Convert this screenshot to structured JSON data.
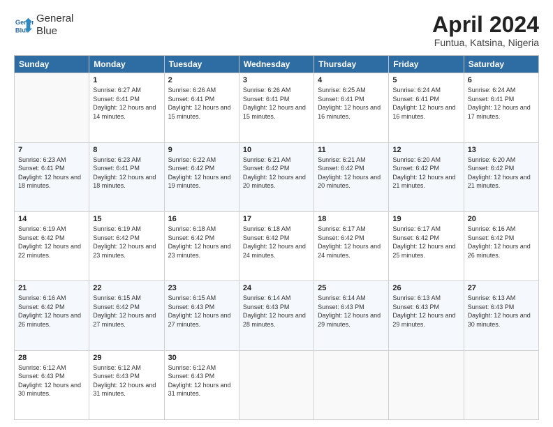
{
  "logo": {
    "line1": "General",
    "line2": "Blue"
  },
  "title": "April 2024",
  "subtitle": "Funtua, Katsina, Nigeria",
  "weekdays": [
    "Sunday",
    "Monday",
    "Tuesday",
    "Wednesday",
    "Thursday",
    "Friday",
    "Saturday"
  ],
  "weeks": [
    [
      {
        "num": "",
        "sunrise": "",
        "sunset": "",
        "daylight": ""
      },
      {
        "num": "1",
        "sunrise": "6:27 AM",
        "sunset": "6:41 PM",
        "daylight": "12 hours and 14 minutes."
      },
      {
        "num": "2",
        "sunrise": "6:26 AM",
        "sunset": "6:41 PM",
        "daylight": "12 hours and 15 minutes."
      },
      {
        "num": "3",
        "sunrise": "6:26 AM",
        "sunset": "6:41 PM",
        "daylight": "12 hours and 15 minutes."
      },
      {
        "num": "4",
        "sunrise": "6:25 AM",
        "sunset": "6:41 PM",
        "daylight": "12 hours and 16 minutes."
      },
      {
        "num": "5",
        "sunrise": "6:24 AM",
        "sunset": "6:41 PM",
        "daylight": "12 hours and 16 minutes."
      },
      {
        "num": "6",
        "sunrise": "6:24 AM",
        "sunset": "6:41 PM",
        "daylight": "12 hours and 17 minutes."
      }
    ],
    [
      {
        "num": "7",
        "sunrise": "6:23 AM",
        "sunset": "6:41 PM",
        "daylight": "12 hours and 18 minutes."
      },
      {
        "num": "8",
        "sunrise": "6:23 AM",
        "sunset": "6:41 PM",
        "daylight": "12 hours and 18 minutes."
      },
      {
        "num": "9",
        "sunrise": "6:22 AM",
        "sunset": "6:42 PM",
        "daylight": "12 hours and 19 minutes."
      },
      {
        "num": "10",
        "sunrise": "6:21 AM",
        "sunset": "6:42 PM",
        "daylight": "12 hours and 20 minutes."
      },
      {
        "num": "11",
        "sunrise": "6:21 AM",
        "sunset": "6:42 PM",
        "daylight": "12 hours and 20 minutes."
      },
      {
        "num": "12",
        "sunrise": "6:20 AM",
        "sunset": "6:42 PM",
        "daylight": "12 hours and 21 minutes."
      },
      {
        "num": "13",
        "sunrise": "6:20 AM",
        "sunset": "6:42 PM",
        "daylight": "12 hours and 21 minutes."
      }
    ],
    [
      {
        "num": "14",
        "sunrise": "6:19 AM",
        "sunset": "6:42 PM",
        "daylight": "12 hours and 22 minutes."
      },
      {
        "num": "15",
        "sunrise": "6:19 AM",
        "sunset": "6:42 PM",
        "daylight": "12 hours and 23 minutes."
      },
      {
        "num": "16",
        "sunrise": "6:18 AM",
        "sunset": "6:42 PM",
        "daylight": "12 hours and 23 minutes."
      },
      {
        "num": "17",
        "sunrise": "6:18 AM",
        "sunset": "6:42 PM",
        "daylight": "12 hours and 24 minutes."
      },
      {
        "num": "18",
        "sunrise": "6:17 AM",
        "sunset": "6:42 PM",
        "daylight": "12 hours and 24 minutes."
      },
      {
        "num": "19",
        "sunrise": "6:17 AM",
        "sunset": "6:42 PM",
        "daylight": "12 hours and 25 minutes."
      },
      {
        "num": "20",
        "sunrise": "6:16 AM",
        "sunset": "6:42 PM",
        "daylight": "12 hours and 26 minutes."
      }
    ],
    [
      {
        "num": "21",
        "sunrise": "6:16 AM",
        "sunset": "6:42 PM",
        "daylight": "12 hours and 26 minutes."
      },
      {
        "num": "22",
        "sunrise": "6:15 AM",
        "sunset": "6:42 PM",
        "daylight": "12 hours and 27 minutes."
      },
      {
        "num": "23",
        "sunrise": "6:15 AM",
        "sunset": "6:43 PM",
        "daylight": "12 hours and 27 minutes."
      },
      {
        "num": "24",
        "sunrise": "6:14 AM",
        "sunset": "6:43 PM",
        "daylight": "12 hours and 28 minutes."
      },
      {
        "num": "25",
        "sunrise": "6:14 AM",
        "sunset": "6:43 PM",
        "daylight": "12 hours and 29 minutes."
      },
      {
        "num": "26",
        "sunrise": "6:13 AM",
        "sunset": "6:43 PM",
        "daylight": "12 hours and 29 minutes."
      },
      {
        "num": "27",
        "sunrise": "6:13 AM",
        "sunset": "6:43 PM",
        "daylight": "12 hours and 30 minutes."
      }
    ],
    [
      {
        "num": "28",
        "sunrise": "6:12 AM",
        "sunset": "6:43 PM",
        "daylight": "12 hours and 30 minutes."
      },
      {
        "num": "29",
        "sunrise": "6:12 AM",
        "sunset": "6:43 PM",
        "daylight": "12 hours and 31 minutes."
      },
      {
        "num": "30",
        "sunrise": "6:12 AM",
        "sunset": "6:43 PM",
        "daylight": "12 hours and 31 minutes."
      },
      {
        "num": "",
        "sunrise": "",
        "sunset": "",
        "daylight": ""
      },
      {
        "num": "",
        "sunrise": "",
        "sunset": "",
        "daylight": ""
      },
      {
        "num": "",
        "sunrise": "",
        "sunset": "",
        "daylight": ""
      },
      {
        "num": "",
        "sunrise": "",
        "sunset": "",
        "daylight": ""
      }
    ]
  ]
}
